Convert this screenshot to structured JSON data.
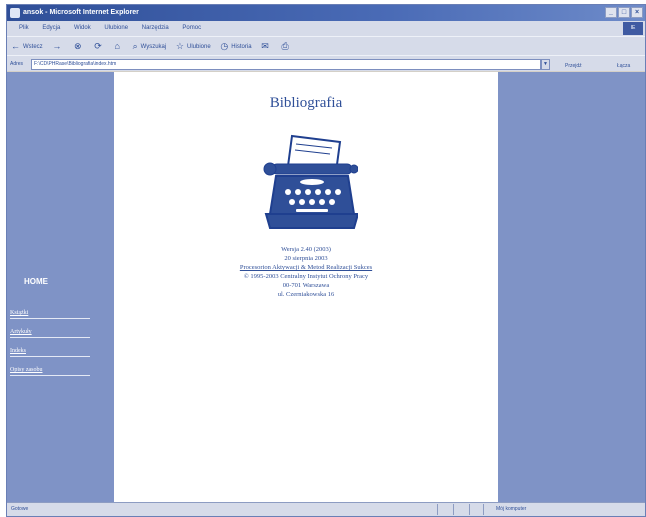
{
  "browser": {
    "title": "ansok - Microsoft Internet Explorer",
    "menu": [
      "Plik",
      "Edycja",
      "Widok",
      "Ulubione",
      "Narzędzia",
      "Pomoc"
    ],
    "toolbar": {
      "back": "Wstecz",
      "forward": "",
      "search": "Wyszukaj",
      "favorites": "Ulubione",
      "media": "Historia"
    },
    "address_label": "Adres",
    "address_value": "F:\\CD\\PHRase\\Bibliografia\\index.htm",
    "go_label": "Przejdź",
    "links_label": "Łącza"
  },
  "sidebar": {
    "home": "HOME",
    "items": [
      "Książki",
      "Artykuły",
      "Indeks",
      "Opisy zasobu"
    ]
  },
  "main": {
    "title": "Bibliografia",
    "lines": [
      "Wersja 2.40 (2003)",
      "20 sierpnia 2003",
      "Procesorion Aktywacji & Metod Realizacji Sukces",
      "© 1995-2003 Centralny Instytut Ochrony Pracy",
      "00-701 Warszawa",
      "ul. Czerniakowska 16"
    ]
  },
  "status": {
    "left": "Gotowe",
    "zone": "Mój komputer"
  },
  "colors": {
    "frame_blue": "#7f93c6",
    "text_blue": "#2f4f98"
  },
  "icons": [
    "ie-icon",
    "typewriter-icon",
    "back-arrow-icon",
    "forward-arrow-icon",
    "stop-icon",
    "refresh-icon",
    "home-icon"
  ]
}
